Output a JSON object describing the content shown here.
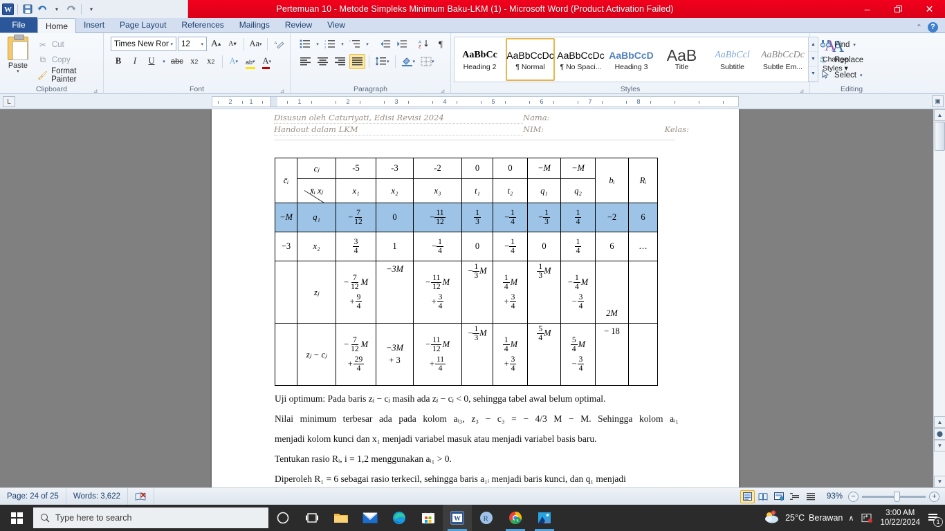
{
  "titlebar": {
    "title": "Pertemuan 10 - Metode Simpleks Minimum Baku-LKM (1)  -  Microsoft Word (Product Activation Failed)",
    "app_logo": "W",
    "qat": [
      {
        "name": "save-icon",
        "glyph": "ὋE"
      },
      {
        "name": "undo-icon",
        "glyph": "↶"
      },
      {
        "name": "redo-icon",
        "glyph": "↷"
      },
      {
        "name": "customize-qat-icon",
        "glyph": "▾"
      }
    ],
    "minimize": "–",
    "restore": "❐",
    "close": "✕"
  },
  "tabs": {
    "file": "File",
    "items": [
      "Home",
      "Insert",
      "Page Layout",
      "References",
      "Mailings",
      "Review",
      "View"
    ],
    "active": "Home",
    "minimize_ribbon": "⌃",
    "help": "?"
  },
  "ribbon": {
    "clipboard": {
      "label": "Clipboard",
      "paste": "Paste",
      "cut": "Cut",
      "copy": "Copy",
      "format_painter": "Format Painter"
    },
    "font": {
      "label": "Font",
      "family": "Times New Rom",
      "size": "12",
      "grow": "A",
      "shrink": "A",
      "change_case": "Aa",
      "clear_formatting": "clear",
      "bold": "B",
      "italic": "I",
      "underline": "U",
      "strikethrough": "abc",
      "subscript": "x",
      "superscript": "x",
      "text_effects": "A",
      "highlight": "ab",
      "font_color": "A"
    },
    "paragraph": {
      "label": "Paragraph",
      "bullets": "•≡",
      "numbering": "1≡",
      "multilevel": "≡",
      "decrease_indent": "←≡",
      "increase_indent": "→≡",
      "sort": "AZ↓",
      "show_marks": "¶",
      "align_left": "left",
      "align_center": "center",
      "align_right": "right",
      "justify": "justify",
      "active_alignment": "justify",
      "line_spacing": "↕≡",
      "shading": "shading",
      "borders": "borders"
    },
    "styles": {
      "label": "Styles",
      "items": [
        {
          "preview": "AaBbCc",
          "name": "Heading 2",
          "style": "serif-bold"
        },
        {
          "preview": "AaBbCcDc",
          "name": "¶ Normal",
          "style": "normal",
          "selected": true
        },
        {
          "preview": "AaBbCcDc",
          "name": "¶ No Spaci...",
          "style": "normal"
        },
        {
          "preview": "AaBbCcD",
          "name": "Heading 3",
          "style": "blue-bold"
        },
        {
          "preview": "AaB",
          "name": "Title",
          "style": "big-light"
        },
        {
          "preview": "AaBbCcl",
          "name": "Subtitle",
          "style": "blue-italic"
        },
        {
          "preview": "AaBbCcDc",
          "name": "Subtle Em...",
          "style": "gray-italic"
        }
      ],
      "change_styles": "Change\nStyles",
      "change_styles_line1": "Change",
      "change_styles_line2": "Styles"
    },
    "editing": {
      "label": "Editing",
      "find": "Find",
      "replace": "Replace",
      "select": "Select"
    }
  },
  "ruler": {
    "corner_tab": "L",
    "left_labels": [
      "2",
      "1"
    ],
    "right_labels": [
      "1",
      "2",
      "3",
      "4",
      "5",
      "6",
      "7",
      "8"
    ]
  },
  "document": {
    "header": {
      "line1_left": "Disusun oleh Caturiyati, Edisi Revisi 2024",
      "line1_right": "Nama:",
      "line2_left": "Handout dalam LKM",
      "line2_mid": "NIM:",
      "line2_right": "Kelas:"
    },
    "table": {
      "row_cj": {
        "label": "cⱼ",
        "values": [
          "-5",
          "-3",
          "-2",
          "0",
          "0",
          "−M",
          "−M"
        ],
        "bi": "bᵢ",
        "ri": "Rᵢ"
      },
      "row_vars": {
        "ci": "c̄ᵢ",
        "xi_xj": "x̄ᵢ    xⱼ",
        "values": [
          "x₁",
          "x₂",
          "x₃",
          "t₁",
          "t₂",
          "q₁",
          "q₂"
        ]
      },
      "row_q1": {
        "ci": "−M",
        "basis": "q₁",
        "cells": [
          {
            "sign": "−",
            "num": "7",
            "den": "12"
          },
          {
            "whole": "0"
          },
          {
            "sign": "−",
            "num": "11",
            "den": "12"
          },
          {
            "num": "1",
            "den": "3"
          },
          {
            "sign": "−",
            "num": "1",
            "den": "4"
          },
          {
            "sign": "−",
            "num": "1",
            "den": "3"
          },
          {
            "num": "1",
            "den": "4"
          }
        ],
        "bi": "−2",
        "ri": "6",
        "highlighted": true
      },
      "row_x2": {
        "ci": "−3",
        "basis": "x₂",
        "cells": [
          {
            "num": "3",
            "den": "4"
          },
          {
            "whole": "1"
          },
          {
            "sign": "−",
            "num": "1",
            "den": "4"
          },
          {
            "whole": "0"
          },
          {
            "sign": "−",
            "num": "1",
            "den": "4"
          },
          {
            "whole": "0"
          },
          {
            "num": "1",
            "den": "4"
          }
        ],
        "bi": "6",
        "ri": "…"
      },
      "row_zj": {
        "label": "zⱼ",
        "cells": [
          {
            "top": {
              "sign": "−",
              "num": "7",
              "den": "12",
              "suffix": "M"
            },
            "bottom": {
              "sign": "+",
              "num": "9",
              "den": "4"
            }
          },
          {
            "top": {
              "whole": "−3M"
            }
          },
          {
            "top": {
              "sign": "−",
              "num": "11",
              "den": "12",
              "suffix": "M"
            },
            "bottom": {
              "sign": "+",
              "num": "3",
              "den": "4"
            }
          },
          {
            "top": {
              "sign": "−",
              "num": "1",
              "den": "3",
              "suffix": "M"
            }
          },
          {
            "top": {
              "num": "1",
              "den": "4",
              "suffix": "M"
            },
            "bottom": {
              "sign": "+",
              "num": "3",
              "den": "4"
            }
          },
          {
            "top": {
              "num": "1",
              "den": "3",
              "suffix": "M"
            }
          },
          {
            "top": {
              "sign": "−",
              "num": "1",
              "den": "4",
              "suffix": "M"
            },
            "bottom": {
              "sign": "−",
              "num": "3",
              "den": "4"
            }
          }
        ],
        "bi": "2M",
        "ri": ""
      },
      "row_zjcj": {
        "label": "zⱼ − cⱼ",
        "cells": [
          {
            "top": {
              "sign": "−",
              "num": "7",
              "den": "12",
              "suffix": "M"
            },
            "bottom": {
              "sign": "+",
              "num": "29",
              "den": "4"
            }
          },
          {
            "top": {
              "whole": "−3M"
            },
            "bottom": {
              "whole": "+ 3"
            }
          },
          {
            "top": {
              "sign": "−",
              "num": "11",
              "den": "12",
              "suffix": "M"
            },
            "bottom": {
              "sign": "+",
              "num": "11",
              "den": "4"
            }
          },
          {
            "top": {
              "sign": "−",
              "num": "1",
              "den": "3",
              "suffix": "M"
            }
          },
          {
            "top": {
              "num": "1",
              "den": "4",
              "suffix": "M"
            },
            "bottom": {
              "sign": "+",
              "num": "3",
              "den": "4"
            }
          },
          {
            "top": {
              "num": "5",
              "den": "4",
              "suffix": "M"
            }
          },
          {
            "top": {
              "num": "5",
              "den": "4",
              "suffix": "M"
            },
            "bottom": {
              "sign": "−",
              "num": "3",
              "den": "4"
            }
          }
        ],
        "bi": "− 18",
        "ri": ""
      }
    },
    "paragraphs": [
      "Uji optimum: Pada baris zⱼ − cⱼ masih ada zⱼ − cⱼ < 0, sehingga tabel awal belum optimal.",
      "Nilai minimum terbesar ada pada kolom aᵢ₃,  z₃ − c₃ = − 4/3 M − M. Sehingga kolom aᵢ₁",
      "menjadi kolom kunci dan x₁ menjadi variabel masuk atau menjadi variabel basis baru.",
      "Tentukan rasio Rᵢ, i = 1,2 menggunakan aᵢ₁ > 0.",
      "Diperoleh R₁ =  6 sebagai rasio terkecil, sehingga baris a₁ᵢ menjadi baris kunci, dan q₁ menjadi"
    ]
  },
  "statusbar": {
    "page": "Page: 24 of 25",
    "words": "Words: 3,622",
    "proofing_icon": "spell-check-icon",
    "views": [
      {
        "name": "print-layout",
        "glyph": "▤",
        "active": true
      },
      {
        "name": "full-screen-reading",
        "glyph": "☷"
      },
      {
        "name": "web-layout",
        "glyph": "▦"
      },
      {
        "name": "outline",
        "glyph": "≡"
      },
      {
        "name": "draft",
        "glyph": "☰"
      }
    ],
    "zoom": "93%",
    "zoom_out": "−",
    "zoom_in": "+"
  },
  "taskbar": {
    "search_placeholder": "Type here to search",
    "items": [
      {
        "name": "cortana-icon",
        "glyph": "◯"
      },
      {
        "name": "task-view-icon",
        "glyph": "⌸"
      },
      {
        "name": "file-explorer-icon",
        "glyph": "folder"
      },
      {
        "name": "mail-icon",
        "glyph": "envelope"
      },
      {
        "name": "edge-icon",
        "glyph": "edge"
      },
      {
        "name": "microsoft-store-icon",
        "glyph": "store"
      },
      {
        "name": "word-icon",
        "glyph": "W",
        "active": true
      },
      {
        "name": "rstudio-icon",
        "glyph": "R"
      },
      {
        "name": "chrome-icon",
        "glyph": "chrome",
        "open": true
      },
      {
        "name": "photos-icon",
        "glyph": "photo",
        "open": true
      }
    ],
    "tray": {
      "temperature": "25°C",
      "weather": "Berawan",
      "show_hidden": "∧",
      "time": "3:00 AM",
      "date": "10/22/2024",
      "notification_count": "1"
    }
  }
}
